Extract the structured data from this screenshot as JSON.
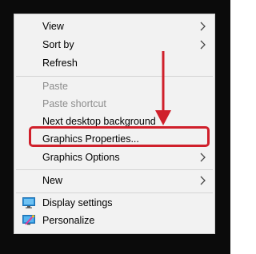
{
  "context_menu": {
    "items": [
      {
        "id": "view",
        "label": "View",
        "submenu": true,
        "disabled": false
      },
      {
        "id": "sort-by",
        "label": "Sort by",
        "submenu": true,
        "disabled": false
      },
      {
        "id": "refresh",
        "label": "Refresh",
        "submenu": false,
        "disabled": false
      },
      {
        "id": "paste",
        "label": "Paste",
        "submenu": false,
        "disabled": true
      },
      {
        "id": "paste-shortcut",
        "label": "Paste shortcut",
        "submenu": false,
        "disabled": true
      },
      {
        "id": "next-desktop-background",
        "label": "Next desktop background",
        "submenu": false,
        "disabled": false
      },
      {
        "id": "graphics-properties",
        "label": "Graphics Properties...",
        "submenu": false,
        "disabled": false,
        "highlighted": true
      },
      {
        "id": "graphics-options",
        "label": "Graphics Options",
        "submenu": true,
        "disabled": false
      },
      {
        "id": "new",
        "label": "New",
        "submenu": true,
        "disabled": false
      },
      {
        "id": "display-settings",
        "label": "Display settings",
        "submenu": false,
        "disabled": false,
        "icon": "monitor-icon"
      },
      {
        "id": "personalize",
        "label": "Personalize",
        "submenu": false,
        "disabled": false,
        "icon": "personalize-icon"
      }
    ]
  },
  "annotation": {
    "arrow_color": "#d0202b",
    "highlight_color": "#d0202b"
  },
  "colors": {
    "menu_background": "#f2f2f2",
    "disabled_text": "#8c8c8c",
    "backdrop": "#0b0b0b"
  }
}
